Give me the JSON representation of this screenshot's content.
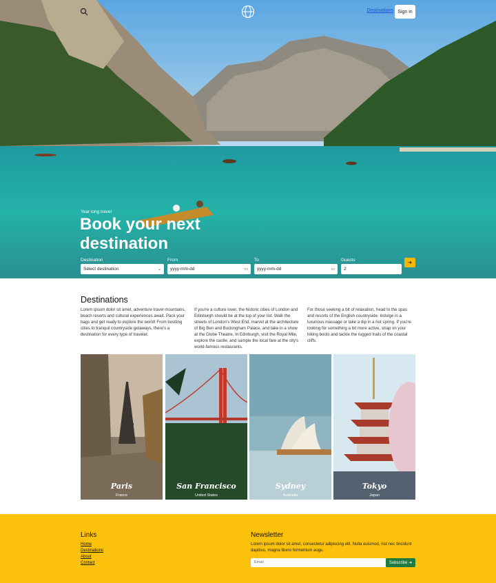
{
  "header": {
    "nav_link": "Destinations",
    "signin": "Sign in"
  },
  "hero": {
    "kicker": "Year long travel",
    "title": "Book your next destination",
    "form": {
      "destination_label": "Destination",
      "destination_value": "Select destination",
      "from_label": "From",
      "from_value": "yyyy-mm-dd",
      "to_label": "To",
      "to_value": "yyyy-mm-dd",
      "guests_label": "Guests",
      "guests_value": "2",
      "submit_glyph": "➜"
    }
  },
  "destinations": {
    "title": "Destinations",
    "columns": [
      "Lorem ipsum dolor sit amet, adventure travel mountains, beach resorts and cultural experiences await. Pack your bags and get ready to explore the world! From bustling cities to tranquil countryside getaways, there's a destination for every type of traveler.",
      "If you're a culture lover, the historic cities of London and Edinburgh should be at the top of your list. Walk the streets of London's West End, marvel at the architecture of Big Ben and Buckingham Palace, and take in a show at the Globe Theatre. In Edinburgh, visit the Royal Mile, explore the castle, and sample the local fare at the city's world-famous restaurants.",
      "For those seeking a bit of relaxation, head to the spas and resorts of the English countryside. Indulge in a luxurious massage or take a dip in a hot spring. If you're looking for something a bit more active, strap on your hiking boots and tackle the rugged trails of the coastal cliffs."
    ],
    "cards": [
      {
        "city": "Paris",
        "country": "France"
      },
      {
        "city": "San Francisco",
        "country": "United States"
      },
      {
        "city": "Sydney",
        "country": "Australia"
      },
      {
        "city": "Tokyo",
        "country": "Japan"
      }
    ]
  },
  "footer": {
    "links_title": "Links",
    "links": [
      "Home",
      "Destinations",
      "About",
      "Contact"
    ],
    "newsletter_title": "Newsletter",
    "newsletter_text": "Lorem ipsum dolor sit amet, consectetur adipiscing elit. Nulla euismod, nisl nec tincidunt dapibus, magna libero fermentum augu.",
    "email_placeholder": "Email",
    "subscribe": "Subscribe ➜"
  },
  "colors": {
    "accent": "#fcc10a",
    "subscribe": "#1f7a3f",
    "link": "#1a4ed8"
  }
}
